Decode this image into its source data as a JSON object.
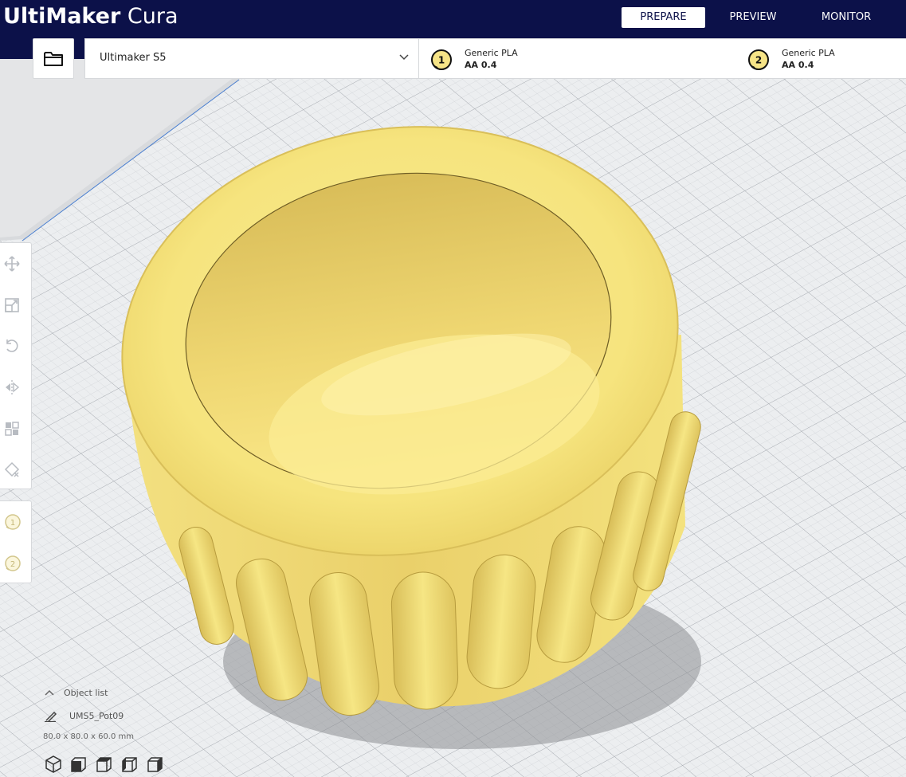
{
  "app": {
    "brand_bold": "UltiMaker",
    "brand_light": " Cura"
  },
  "stages": {
    "prepare": "PREPARE",
    "preview": "PREVIEW",
    "monitor": "MONITOR",
    "active": "prepare"
  },
  "printer": {
    "name": "Ultimaker S5"
  },
  "extruders": [
    {
      "number": "1",
      "material": "Generic PLA",
      "core": "AA 0.4"
    },
    {
      "number": "2",
      "material": "Generic PLA",
      "core": "AA 0.4"
    }
  ],
  "tools": {
    "icons": [
      "move-icon",
      "scale-icon",
      "rotate-icon",
      "mirror-icon",
      "per-model-settings-icon",
      "support-blocker-icon"
    ],
    "extruder_selectors": [
      "1",
      "2"
    ]
  },
  "object_list": {
    "title": "Object list",
    "item_name": "UMS5_Pot09",
    "dimensions": "80.0 x 80.0 x 60.0 mm",
    "view_buttons": [
      "3d-view-icon",
      "front-view-icon",
      "top-view-icon",
      "left-view-icon",
      "right-view-icon"
    ]
  },
  "colors": {
    "header_bg": "#0c1149",
    "model_yellow": "#f3e27a",
    "build_plate": "#ecedef"
  }
}
